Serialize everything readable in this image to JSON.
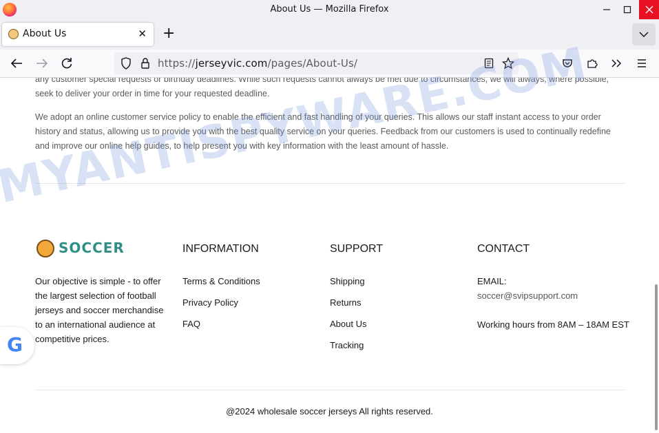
{
  "window": {
    "title": "About Us — Mozilla Firefox"
  },
  "tab": {
    "label": "About Us"
  },
  "address": {
    "scheme": "https://",
    "host": "jerseyvic.com",
    "path": "/pages/About-Us/"
  },
  "content": {
    "paragraph1": "any customer special requests or birthday deadlines. While such requests cannot always be met due to circumstances, we will always, where possible, seek to deliver your order in time for your requested deadline.",
    "paragraph2": "We adopt an online customer service policy to enable the efficient and fast handling of your queries. This allows our staff instant access to your order history and status, allowing us to provide you with the best quality service on your queries. Feedback from our customers is used to continually redefine and improve our online help guides, to help present you with key information with the least amount of hassle."
  },
  "footer": {
    "logo_text": "SOCCER",
    "about": "Our objective is simple - to offer the largest selection of football jerseys and soccer merchandise to an international audience at competitive prices.",
    "information": {
      "heading": "INFORMATION",
      "links": [
        "Terms & Conditions",
        "Privacy Policy",
        "FAQ"
      ]
    },
    "support": {
      "heading": "SUPPORT",
      "links": [
        "Shipping",
        "Returns",
        "About Us",
        "Tracking"
      ]
    },
    "contact": {
      "heading": "CONTACT",
      "email_label": "EMAIL:",
      "email": "soccer@svipsupport.com",
      "hours": "Working hours from 8AM – 18AM EST"
    },
    "copyright": "@2024 wholesale soccer jerseys All rights reserved."
  },
  "google_badge": {
    "letter": "G"
  },
  "watermark": "MYANTISPYWARE.COM"
}
